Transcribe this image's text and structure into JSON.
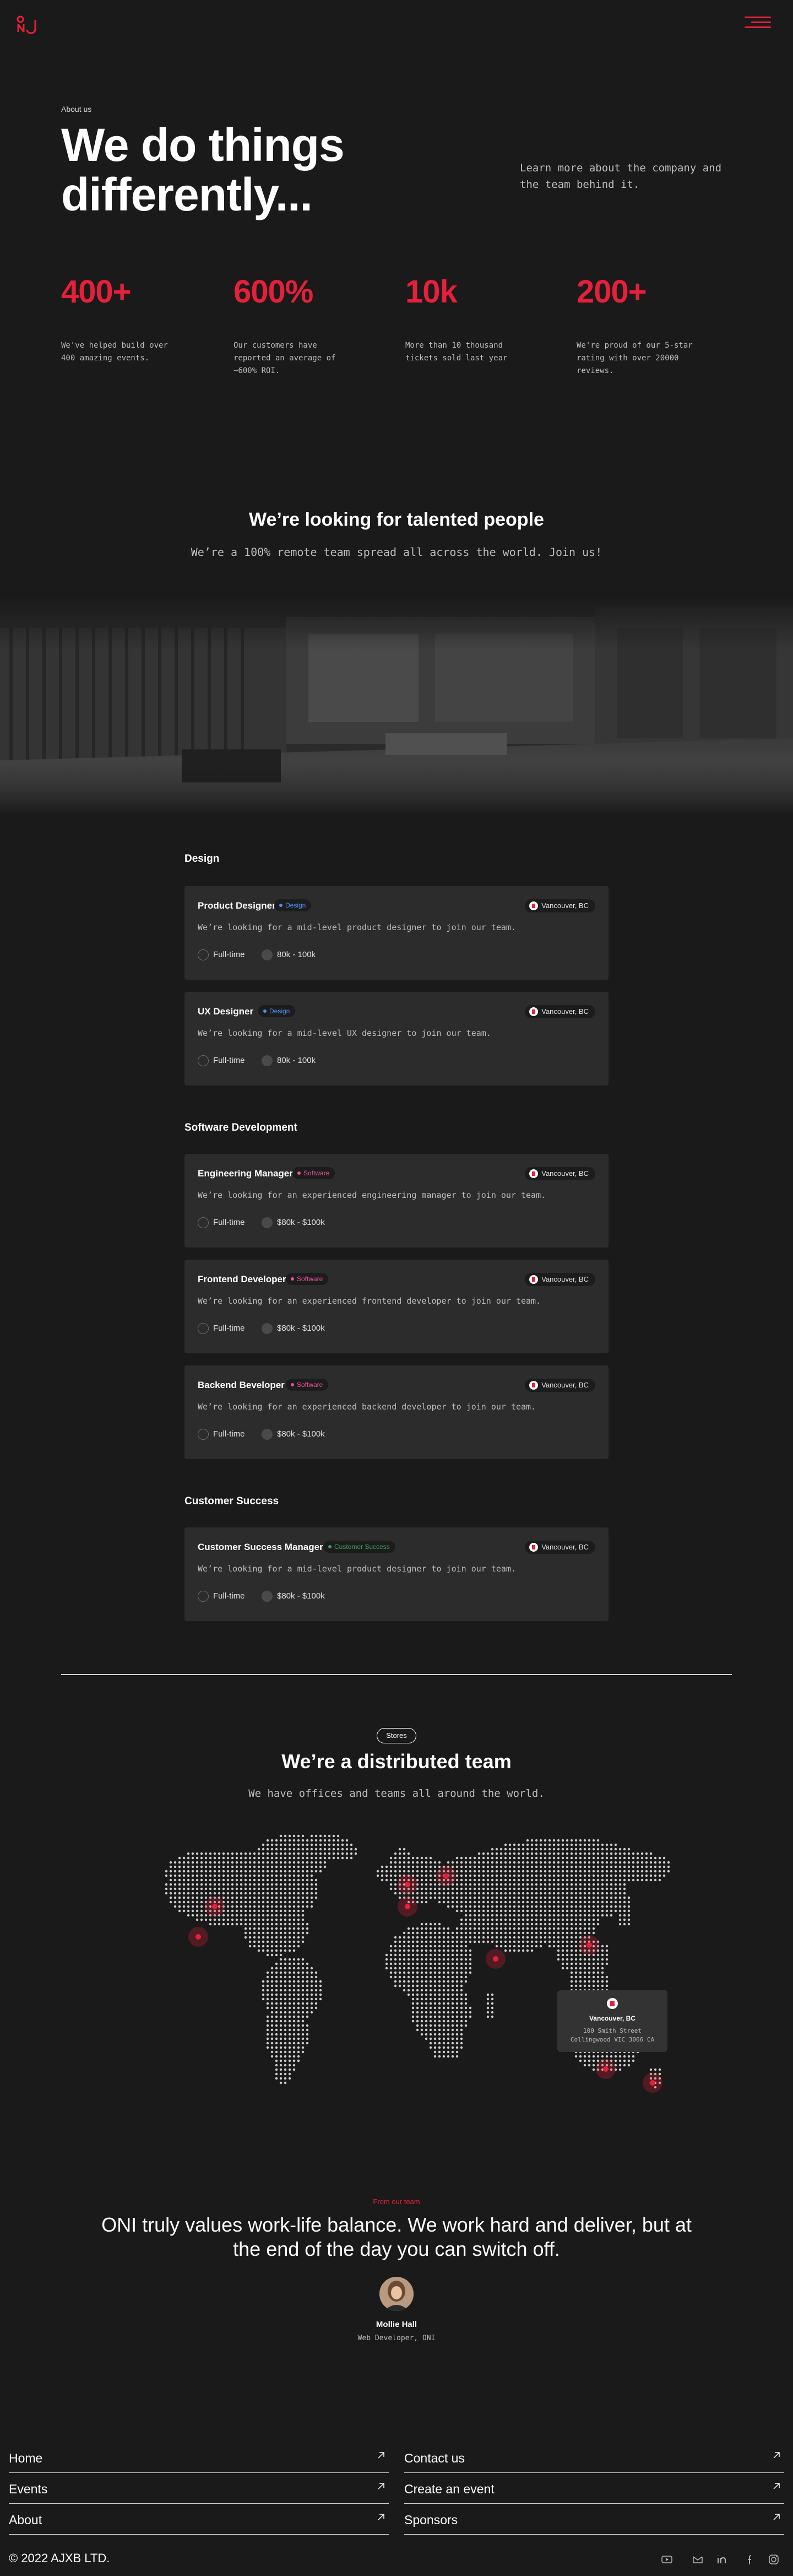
{
  "header": {
    "logo_icon": "oni-logo-icon",
    "menu_icon": "hamburger-menu-icon"
  },
  "hero": {
    "eyebrow": "About us",
    "title_line1": "We do things",
    "title_line2": "differently...",
    "side_text": "Learn more about the company and the team behind it."
  },
  "stats": [
    {
      "value": "400+",
      "desc": "We've helped build over 400 amazing events."
    },
    {
      "value": "600%",
      "desc": "Our customers have reported an average of ~600% ROI."
    },
    {
      "value": "10k",
      "desc": "More than 10 thousand tickets sold last year"
    },
    {
      "value": "200+",
      "desc": "We're proud of our 5-star rating with over 20000 reviews."
    }
  ],
  "careers": {
    "title": "We’re looking for talented people",
    "subtitle": "We’re a 100% remote team spread all across the world. Join us!"
  },
  "departments": [
    {
      "name": "Design",
      "jobs": [
        {
          "title": "Product Designer",
          "tag": "Design",
          "location": "Vancouver, BC",
          "desc": "We’re looking for a mid-level product designer to join our team.",
          "type": "Full-time",
          "salary": "80k - 100k"
        },
        {
          "title": "UX Designer",
          "tag": "Design",
          "location": "Vancouver, BC",
          "desc": "We’re looking for a mid-level UX designer to join our team.",
          "type": "Full-time",
          "salary": "80k - 100k"
        }
      ]
    },
    {
      "name": "Software Development",
      "jobs": [
        {
          "title": "Engineering Manager",
          "tag": "Software",
          "location": "Vancouver, BC",
          "desc": "We’re looking for an experienced engineering manager to join our team.",
          "type": "Full-time",
          "salary": "$80k - $100k"
        },
        {
          "title": "Frontend Developer",
          "tag": "Software",
          "location": "Vancouver, BC",
          "desc": "We’re looking for an experienced frontend developer to join our team.",
          "type": "Full-time",
          "salary": "$80k - $100k"
        },
        {
          "title": "Backend Beveloper",
          "tag": "Software",
          "location": "Vancouver, BC",
          "desc": "We’re looking for an experienced backend developer to join our team.",
          "type": "Full-time",
          "salary": "$80k - $100k"
        }
      ]
    },
    {
      "name": "Customer Success",
      "jobs": [
        {
          "title": "Customer Success Manager",
          "tag": "Customer Success",
          "location": "Vancouver, BC",
          "desc": "We’re looking for a mid-level product designer to join our team.",
          "type": "Full-time",
          "salary": "$80k - $100k"
        }
      ]
    }
  ],
  "offices": {
    "pill": "Stores",
    "title": "We’re a distributed team",
    "subtitle": "We have offices and teams all around the world.",
    "popup": {
      "city": "Vancouver, BC",
      "address_line1": "100 Smith Street",
      "address_line2": "Collingwood VIC 3066 CA"
    }
  },
  "testimonial": {
    "eyebrow": "From our team",
    "quote": "ONI truly values work-life balance. We work hard and deliver, but at the end of the day you can switch off.",
    "name": "Mollie Hall",
    "role": "Web Developer, ONI"
  },
  "footer": {
    "links_left": [
      "Home",
      "Events",
      "About"
    ],
    "links_right": [
      "Contact us",
      "Create an event",
      "Sponsors"
    ],
    "copyright": "© 2022 AJXB LTD.",
    "social_icons": [
      "youtube-icon",
      "mail-icon",
      "linkedin-icon",
      "facebook-icon",
      "instagram-icon"
    ]
  },
  "colors": {
    "accent": "#e5203a",
    "background": "#1a1a1a",
    "card": "#2c2c2c",
    "design_tag": "#4f8ff7",
    "software_tag": "#f0509a",
    "customer_success_tag": "#3aa55d"
  }
}
